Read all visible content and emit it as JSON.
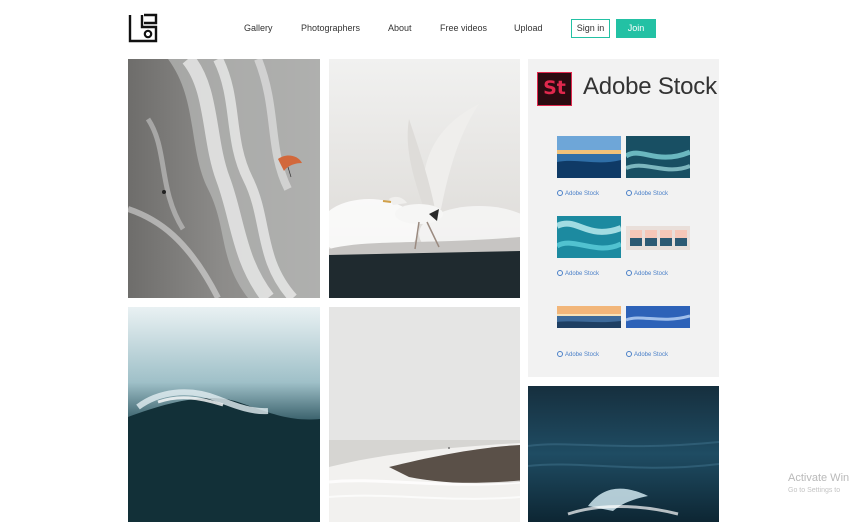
{
  "header": {
    "logo": "site-logo-icon",
    "nav": [
      "Gallery",
      "Photographers",
      "About",
      "Free videos",
      "Upload"
    ],
    "sign_in": "Sign in",
    "join": "Join"
  },
  "colors": {
    "accent": "#23c1a4",
    "adobe_red": "#e0284d",
    "adobe_dark": "#2b0b11",
    "ad_background": "#f2f2f2",
    "ad_link": "#4b80c8"
  },
  "gallery": {
    "photos": [
      {
        "subject": "aerial-surf-kitesurfer"
      },
      {
        "subject": "seagull-wings-spread"
      },
      {
        "subject": "dark-ocean-wave"
      },
      {
        "subject": "misty-beach-shore"
      },
      {
        "subject": "deep-blue-sea-wave"
      }
    ]
  },
  "ad": {
    "logo_text": "St",
    "title": "Adobe Stock",
    "thumbnails": [
      {
        "caption": "Adobe Stock"
      },
      {
        "caption": "Adobe Stock"
      },
      {
        "caption": "Adobe Stock"
      },
      {
        "caption": "Adobe Stock"
      },
      {
        "caption": "Adobe Stock"
      },
      {
        "caption": "Adobe Stock"
      }
    ]
  },
  "watermark": {
    "line1": "Activate Win",
    "line2": "Go to Settings to"
  }
}
